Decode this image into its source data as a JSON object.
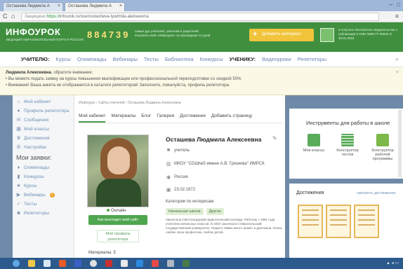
{
  "browser": {
    "tabs": [
      {
        "label": "Осташева Людмила А",
        "active": false
      },
      {
        "label": "Осташева Людмила А",
        "active": true
      }
    ],
    "address": {
      "security_label": "Защищено",
      "protocol": "https://",
      "url": "infourok.ru/user/ostasheva-lyudmila-alekseevna"
    }
  },
  "site": {
    "logo": "ИНФОУРОК",
    "logo_sub": "ВЕДУЩИЙ ОБРАЗОВАТЕЛЬНЫЙ ПОРТАЛ РОССИИ",
    "counter": "884739",
    "counter_text": "самых дух учителей, учителей и родителей получили свой «Инфоурок» за прошедшие 14 дней",
    "add_material": "Добавить материал",
    "certificate_text": "и получить бесплатное свидетельство о публикации в СМИ №ФС77-60625 от 20.01.2015"
  },
  "catnav": {
    "teacher_label": "УЧИТЕЛЮ:",
    "teacher_items": [
      "Курсы",
      "Олимпиады",
      "Вебинары",
      "Тесты",
      "Библиотека",
      "Конкурсы"
    ],
    "student_label": "УЧЕНИКУ:",
    "student_items": [
      "Видеоуроки",
      "Репетиторы"
    ]
  },
  "notice": {
    "greeting_name": "Людмила Алексеевна",
    "greeting_rest": ", обратите внимание:",
    "line1": "Вы можете подать заявку на курсы повышения квалификации или профессиональной переподготовки со скидкой 50%",
    "line2": "Внимание! Ваша анкета не отображается в каталоге репетиторов! Заполните, пожалуйста, профиль репетитора."
  },
  "sidebar": {
    "items": [
      {
        "label": "Мой кабинет",
        "icon": "home-icon"
      },
      {
        "label": "Профиль репетитора",
        "icon": "user-icon"
      },
      {
        "label": "Сообщения",
        "icon": "message-icon"
      },
      {
        "label": "Мой классы",
        "icon": "class-icon"
      },
      {
        "label": "Достижения",
        "icon": "trophy-icon"
      },
      {
        "label": "Настройки",
        "icon": "gear-icon"
      }
    ],
    "requests_title": "Мои заявки:",
    "requests": [
      {
        "label": "Олимпиады",
        "icon": "medal-icon"
      },
      {
        "label": "Конкурсы",
        "icon": "chart-icon"
      },
      {
        "label": "Курсы",
        "icon": "star-icon"
      },
      {
        "label": "Вебинары",
        "icon": "play-icon",
        "badge": "1"
      },
      {
        "label": "Тесты",
        "icon": "check-icon"
      },
      {
        "label": "Репетиторы",
        "icon": "people-icon"
      }
    ]
  },
  "main": {
    "breadcrumb": "Инфоурок › Сайты учителей › Осташева Людмила Алексеевна",
    "tabs": [
      "Мой кабинет",
      "Материалы",
      "Блог",
      "Галерея",
      "Достижения",
      "Добавить страницу"
    ],
    "name": "Осташева Людмила Алексеевна",
    "role": "учитель",
    "school": "МКОУ \"СОШ№5 имени А.В. Грязнова\" ИМРСК",
    "country": "Россия",
    "birthdate": "23.02.1972",
    "online": "Онлайн",
    "photo_button": "Как выглядит мой сайт",
    "tutor_button": "Мой профиль репетитора",
    "materials": "Материалы: 5",
    "interests_label": "Категории по интересам:",
    "interests": [
      "Начальная школа",
      "Другое"
    ],
    "bio": "Закончила Светлоградский педагогический колледж. Работаю с 1991 года учителем начальных классов. В 2002 закончила Ставропольский государственный университет. Педагог. Имею много грамот и дипломов. Очень люблю свою профессию, люблю детей."
  },
  "tools": {
    "title": "Инструменты для работы в школе",
    "items": [
      {
        "label": "Мои классы",
        "icon": "classes-icon"
      },
      {
        "label": "Конструктор тестов",
        "icon": "tests-icon"
      },
      {
        "label": "Конструктор рабочей программы",
        "icon": "program-icon"
      }
    ]
  },
  "achievements": {
    "title": "Достижения",
    "link": "смотреть достижения",
    "count": 3
  },
  "colors": {
    "brand_green": "#3f8f3f",
    "accent_yellow": "#f2c43b",
    "link_blue": "#6f8fb4"
  }
}
